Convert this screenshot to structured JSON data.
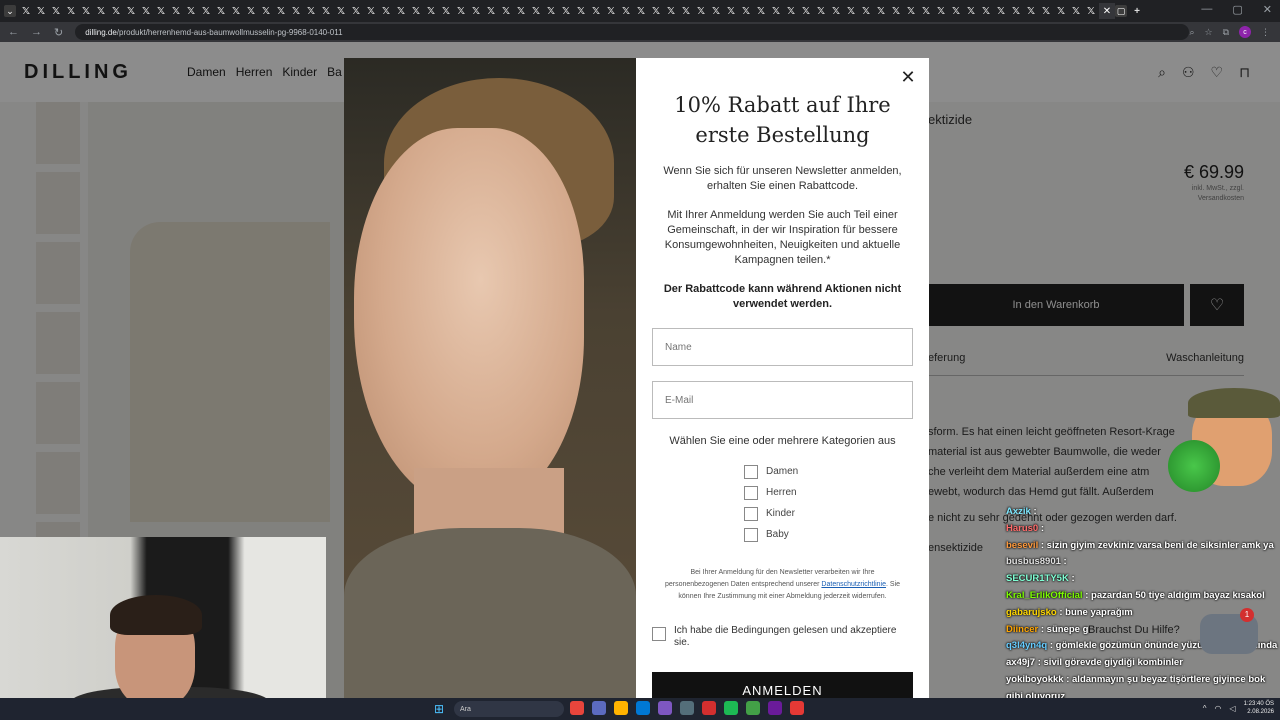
{
  "browser": {
    "url_domain": "dilling.de",
    "url_path": "/produkt/herrenhemd-aus-baumwollmusselin-pg-9968-0140-011"
  },
  "site": {
    "logo": "DILLING",
    "nav": [
      "Damen",
      "Herren",
      "Kinder",
      "Ba"
    ],
    "product_title_fragment": "ektizide",
    "price": "€ 69.99",
    "price_note_1": "inkl. MwSt., zzgl.",
    "price_note_2": "Versandkosten",
    "add_to_cart": "In den Warenkorb",
    "tab_delivery": "eferung",
    "tab_care": "Waschanleitung",
    "desc_1": "sform. Es hat einen leicht geöffneten Resort-Krage",
    "desc_2": "material ist aus gewebter Baumwolle, die weder",
    "desc_3": "che verleiht dem Material außerdem eine atm",
    "desc_4": "ewebt, wodurch das Hemd gut fällt. Außerdem",
    "extra_1": "e nicht zu sehr gedehnt oder gezogen werden darf.",
    "extra_2": "ensektizide",
    "help": "Brauchst Du Hilfe?"
  },
  "modal": {
    "title_line1": "10% Rabatt auf Ihre",
    "title_line2": "erste Bestellung",
    "para1": "Wenn Sie sich für unseren Newsletter anmelden, erhalten Sie einen Rabattcode.",
    "para2": "Mit Ihrer Anmeldung werden Sie auch Teil einer Gemeinschaft, in der wir Inspiration für bessere Konsumgewohnheiten, Neuigkeiten und aktuelle Kampagnen teilen.*",
    "bold_note": "Der Rabattcode kann während Aktionen nicht verwendet werden.",
    "name_placeholder": "Name",
    "email_placeholder": "E-Mail",
    "category_prompt": "Wählen Sie eine oder mehrere Kategorien aus",
    "categories": [
      "Damen",
      "Herren",
      "Kinder",
      "Baby"
    ],
    "fine_1": "Bei Ihrer Anmeldung für den Newsletter verarbeiten wir Ihre personenbezogenen Daten entsprechend unserer",
    "fine_link": "Datenschutzrichtlinie",
    "fine_2": ". Sie können Ihre Zustimmung mit einer Abmeldung jederzeit widerrufen.",
    "terms": "Ich habe die Bedingungen gelesen und akzeptiere sie.",
    "submit": "ANMELDEN"
  },
  "chat": [
    {
      "user": "Axzik",
      "msg": ""
    },
    {
      "user": "Harus0",
      "msg": ""
    },
    {
      "user": "besevil",
      "msg": "sizin giyim zevkiniz varsa beni de siksinler amk ya"
    },
    {
      "user": "busbus8901",
      "msg": ""
    },
    {
      "user": "SECUR1TY5K",
      "msg": ""
    },
    {
      "user": "Kral_ErlikOfficial",
      "msg": "pazardan 50 tiye aldığım bayaz kısakol"
    },
    {
      "user": "gabarujsko",
      "msg": "bune yaprağım"
    },
    {
      "user": "Diincer",
      "msg": "sünepe g"
    },
    {
      "user": "q3l4yn4q",
      "msg": "gömlekle gözümün önünde yüzü canlandı anında"
    },
    {
      "user": "ax49j7",
      "msg": "sivil görevde giydiği kombinler"
    },
    {
      "user": "yokiboyokkk",
      "msg": "aldanmayın şu beyaz tişörtlere giyince bok gibi oluyoruz"
    }
  ],
  "chat_badge": "1",
  "taskbar": {
    "search_placeholder": "Ara",
    "time": "1:23:40 ÖS",
    "date": "2.08.2026"
  }
}
